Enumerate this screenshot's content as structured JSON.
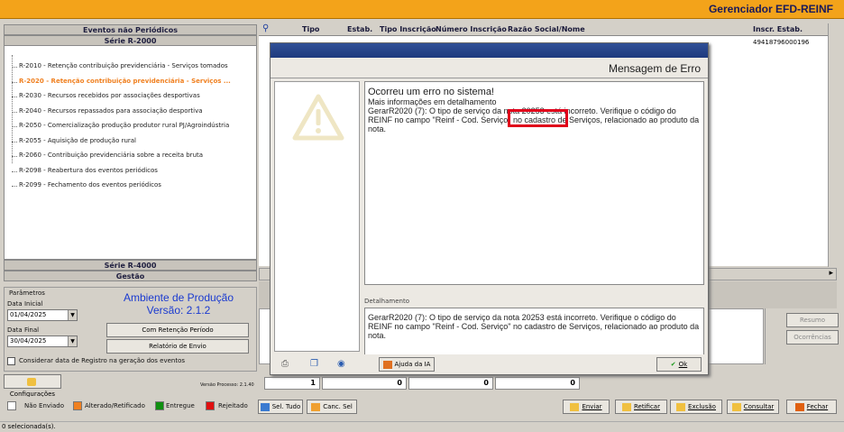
{
  "app": {
    "title": "Gerenciador EFD-REINF"
  },
  "left": {
    "header_eventos": "Eventos não Periódicos",
    "header_serie2000": "Série R-2000",
    "items": [
      "R-2010 - Retenção contribuição previdenciária - Serviços tomados",
      "R-2020 - Retenção contribuição previdenciária - Serviços ...",
      "R-2030 - Recursos recebidos por associações desportivas",
      "R-2040 - Recursos repassados para associação desportiva",
      "R-2050 - Comercialização produção produtor rural PJ/Agroindústria",
      "R-2055 - Aquisição de produção rural",
      "R-2060 - Contribuição previdenciária sobre a receita bruta",
      "R-2098 - Reabertura dos eventos periódicos",
      "R-2099 - Fechamento dos eventos periódicos"
    ],
    "selected_index": 1,
    "header_serie4000": "Série R-4000",
    "header_gestao": "Gestão"
  },
  "params": {
    "group_label": "Parâmetros",
    "data_inicial_label": "Data Inicial",
    "data_inicial": "01/04/2025",
    "data_final_label": "Data Final",
    "data_final": "30/04/2025",
    "ambiente": "Ambiente de Produção",
    "versao": "Versão: 2.1.2",
    "btn_retencao": "Com Retenção Período",
    "btn_relatorio": "Relatório de Envio",
    "checkbox_label": "Considerar data de Registro na geração dos eventos",
    "btn_config": "Configurações",
    "versao_processo": "Versão Processo: 2.1.40"
  },
  "grid": {
    "columns": [
      "Tipo",
      "Estab.",
      "Tipo Inscrição",
      "Número Inscrição",
      "Razão Social/Nome",
      "Inscr. Estab."
    ],
    "inscr_estab_value": "49418796000196"
  },
  "dialog": {
    "title": "Mensagem de Erro",
    "line1": "Ocorreu um erro no sistema!",
    "line2": "Mais informações em detalhamento",
    "message": "GerarR2020 (7): O tipo de serviço da nota  20253 está incorreto. Verifique o código do REINF no campo \"Reinf - Cod. Serviço\" no cadastro de Serviços, relacionado ao produto da nota.",
    "detalhamento_label": "Detalhamento",
    "detalhamento": "GerarR2020 (7): O tipo de serviço da nota  20253 está incorreto. Verifique o código do REINF no campo \"Reinf - Cod. Serviço\" no cadastro de Serviços, relacionado ao produto da nota.",
    "btn_ajuda": "Ajuda da IA",
    "btn_ok": "Ok"
  },
  "counters": [
    "1",
    "0",
    "0",
    "0"
  ],
  "right_buttons": {
    "resumo": "Resumo",
    "ocorrencias": "Ocorrências"
  },
  "legend": [
    {
      "label": "Não Enviado",
      "color": "#ffffff"
    },
    {
      "label": "Alterado/Retificado",
      "color": "#f08020"
    },
    {
      "label": "Entregue",
      "color": "#109010"
    },
    {
      "label": "Rejeitado",
      "color": "#e01010"
    }
  ],
  "toolbar": {
    "sel_tudo": "Sel. Tudo",
    "canc_sel": "Canc. Sel",
    "enviar": "Enviar",
    "retificar": "Retificar",
    "exclusao": "Exclusão",
    "consultar": "Consultar",
    "fechar": "Fechar"
  },
  "status": "0 selecionada(s)."
}
